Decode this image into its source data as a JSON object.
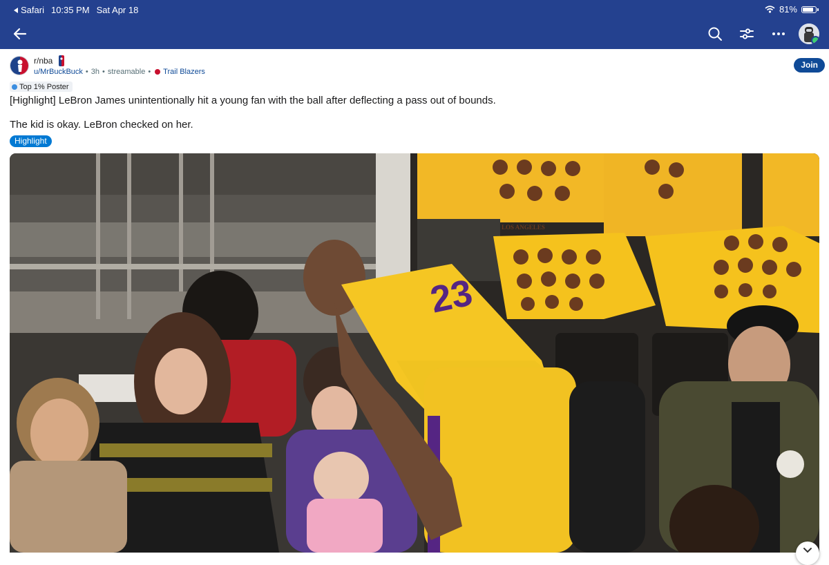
{
  "status_bar": {
    "app": "Safari",
    "time": "10:35 PM",
    "date": "Sat Apr 18",
    "battery": "81%",
    "battery_level": 0.81
  },
  "nav": {
    "icons": [
      "back-arrow-icon",
      "search-icon",
      "filter-icon",
      "more-icon",
      "user-avatar"
    ]
  },
  "post": {
    "subreddit": "r/nba",
    "author": "u/MrBuckBuck",
    "age": "3h",
    "source": "streamable",
    "user_flair": "Trail Blazers",
    "join_label": "Join",
    "poster_badge": "Top 1% Poster",
    "title": "[Highlight] LeBron James unintentionally hit a young fan with the ball after deflecting a pass out of bounds.",
    "body": "The kid is okay. LeBron checked on her.",
    "post_flair": "Highlight"
  },
  "media": {
    "jersey_number": "23",
    "shirt_text": "LOS ANGELES"
  },
  "colors": {
    "header": "#24418f",
    "accent": "#0f4a97",
    "flair": "#0079d3",
    "lakers_gold": "#f5c623",
    "lakers_purple": "#552583"
  }
}
